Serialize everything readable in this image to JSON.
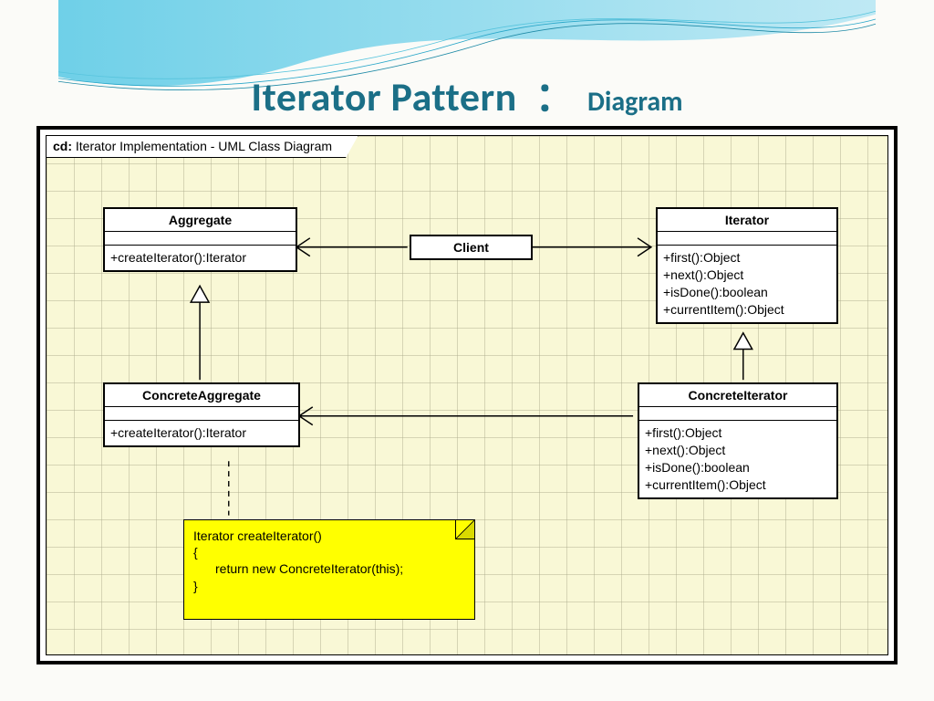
{
  "title": {
    "main": "Iterator Pattern",
    "colon": "：",
    "sub": "Diagram"
  },
  "diagram": {
    "tab_prefix": "cd:",
    "tab_label": "Iterator Implementation - UML Class Diagram",
    "classes": {
      "aggregate": {
        "name": "Aggregate",
        "ops": [
          "+createIterator():Iterator"
        ]
      },
      "iterator": {
        "name": "Iterator",
        "ops": [
          "+first():Object",
          "+next():Object",
          "+isDone():boolean",
          "+currentItem():Object"
        ]
      },
      "client": {
        "name": "Client"
      },
      "concreteAggregate": {
        "name": "ConcreteAggregate",
        "ops": [
          "+createIterator():Iterator"
        ]
      },
      "concreteIterator": {
        "name": "ConcreteIterator",
        "ops": [
          "+first():Object",
          "+next():Object",
          "+isDone():boolean",
          "+currentItem():Object"
        ]
      }
    },
    "note": {
      "line1": "Iterator createIterator()",
      "line2": "{",
      "line3_indent": "    ",
      "line3": "return new ConcreteIterator(this);",
      "line4": "}"
    },
    "relationships": [
      {
        "from": "Client",
        "to": "Aggregate",
        "type": "association"
      },
      {
        "from": "Client",
        "to": "Iterator",
        "type": "association"
      },
      {
        "from": "ConcreteAggregate",
        "to": "Aggregate",
        "type": "generalization"
      },
      {
        "from": "ConcreteIterator",
        "to": "Iterator",
        "type": "generalization"
      },
      {
        "from": "ConcreteIterator",
        "to": "ConcreteAggregate",
        "type": "association"
      },
      {
        "from": "note",
        "to": "ConcreteAggregate",
        "type": "anchor"
      }
    ]
  }
}
